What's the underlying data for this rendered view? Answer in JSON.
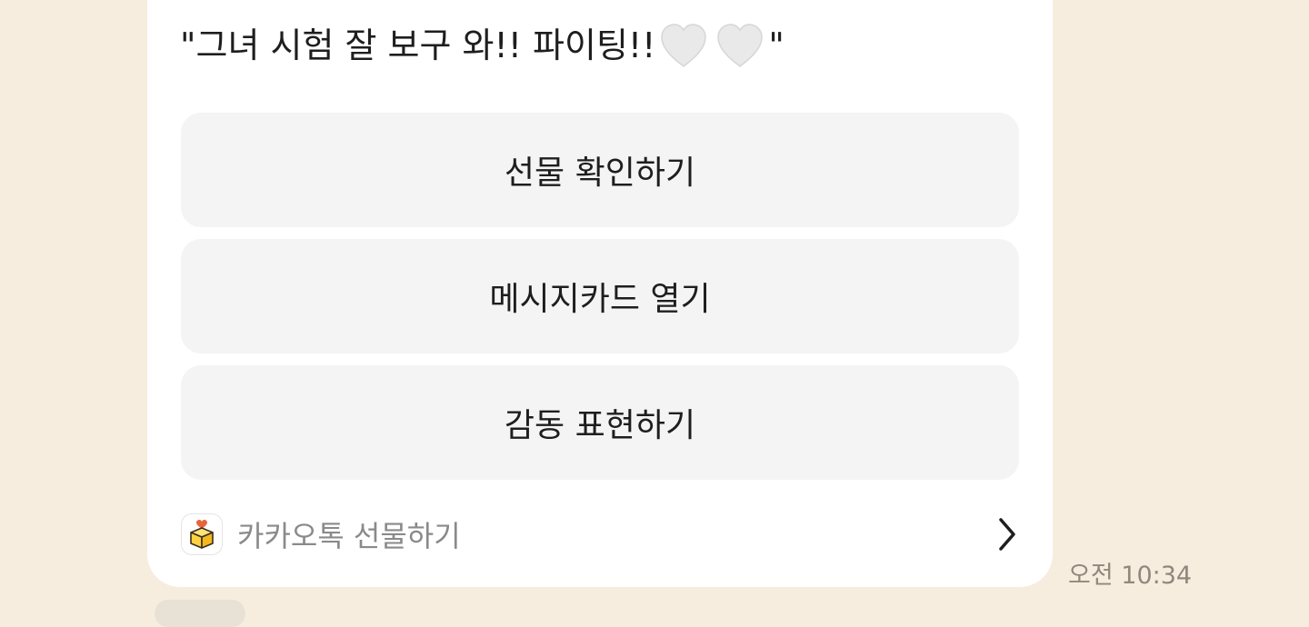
{
  "message": {
    "text_before": "\"그녀 시험 잘 보구 와!! 파이팅!!",
    "heart_icons": [
      "white-heart-icon",
      "white-heart-icon"
    ],
    "text_after": "\""
  },
  "actions": [
    {
      "label": "선물 확인하기"
    },
    {
      "label": "메시지카드 열기"
    },
    {
      "label": "감동 표현하기"
    }
  ],
  "footer": {
    "label": "카카오톡 선물하기",
    "icon": "gift-box-icon",
    "chevron": "chevron-right-icon"
  },
  "timestamp": "오전 10:34",
  "colors": {
    "background": "#F6EDDE",
    "card": "#FFFFFF",
    "button": "#F4F4F4"
  }
}
